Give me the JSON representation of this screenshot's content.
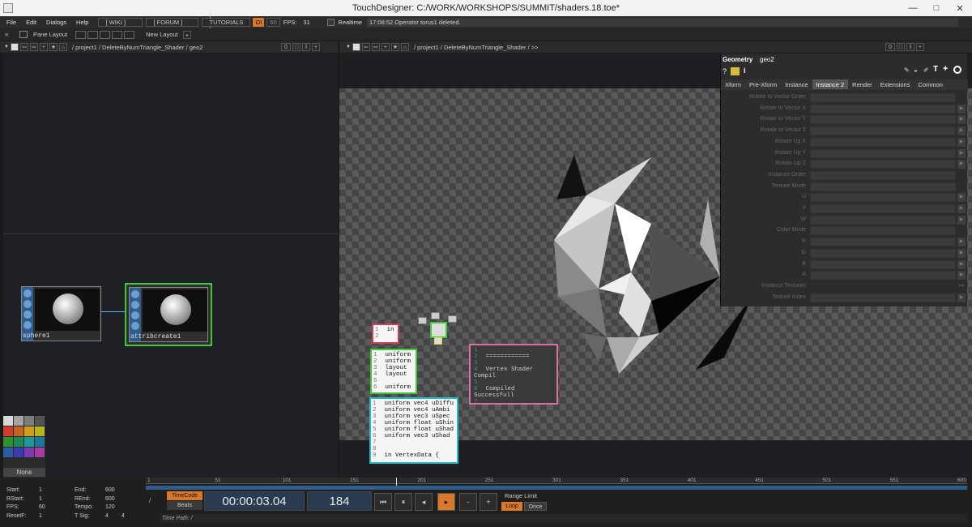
{
  "window": {
    "title": "TouchDesigner: C:/WORK/WORKSHOPS/SUMMIT/shaders.18.toe*"
  },
  "menu": {
    "items": [
      "File",
      "Edit",
      "Dialogs",
      "Help"
    ],
    "links": [
      "[ WIKI ]",
      "[ FORUM ]",
      "[ TUTORIALS ]"
    ],
    "oi": "OI",
    "fps_target": "60",
    "fps_label": "FPS:",
    "fps_value": "31",
    "realtime": "Realtime",
    "status": "17:08:52 Operator torus1 deleted."
  },
  "layoutbar": {
    "pane_layout": "Pane Layout",
    "new_layout": "New Layout",
    "plus": "+"
  },
  "leftpane": {
    "path": "/ project1 / DeleteByNumTriangle_Shader / geo2",
    "num": "0"
  },
  "rightpane": {
    "path": "/ project1 / DeleteByNumTriangle_Shader / >>",
    "num": "0"
  },
  "nodes": {
    "sphere": "sphere1",
    "attrib": "attribcreate1"
  },
  "code": {
    "red": [
      "1",
      "2"
    ],
    "red_text": "in",
    "green": [
      "uniform",
      "uniform",
      "layout",
      "layout",
      "",
      "uniform"
    ],
    "cyan": [
      "uniform vec4 uDiffu",
      "uniform vec4 uAmbi",
      "uniform vec3 uSpec",
      "uniform float uShin",
      "uniform float uShad",
      "uniform vec3 uShad",
      "",
      "",
      "in VertexData {"
    ],
    "pink": [
      "",
      "============",
      "",
      "Vertex Shader Compil",
      "",
      "Compiled Successfull",
      "",
      "============",
      ""
    ]
  },
  "params": {
    "type": "Geometry",
    "name": "geo2",
    "tabs": [
      "Xform",
      "Pre-Xform",
      "Instance",
      "Instance 2",
      "Render",
      "Extensions",
      "Common"
    ],
    "active_tab": "Instance 2",
    "rows": [
      {
        "label": "Rotate to Vector Order",
        "value": "",
        "kind": "menu"
      },
      {
        "label": "Rotate to Vector X",
        "value": "",
        "kind": "arrow"
      },
      {
        "label": "Rotate to Vector Y",
        "value": "",
        "kind": "arrow"
      },
      {
        "label": "Rotate to Vector Z",
        "value": "",
        "kind": "arrow"
      },
      {
        "label": "Rotate Up X",
        "value": "",
        "kind": "arrow"
      },
      {
        "label": "Rotate Up Y",
        "value": "",
        "kind": "arrow"
      },
      {
        "label": "Rotate Up Z",
        "value": "",
        "kind": "arrow"
      },
      {
        "label": "Instance Order",
        "value": "",
        "kind": "menu"
      },
      {
        "label": "Texture Mode",
        "value": "",
        "kind": "menu"
      },
      {
        "label": "U",
        "value": "",
        "kind": "arrow"
      },
      {
        "label": "V",
        "value": "",
        "kind": "arrow"
      },
      {
        "label": "W",
        "value": "",
        "kind": "arrow"
      },
      {
        "label": "Color Mode",
        "value": "",
        "kind": "menu"
      },
      {
        "label": "R",
        "value": "",
        "kind": "arrow"
      },
      {
        "label": "G",
        "value": "",
        "kind": "arrow"
      },
      {
        "label": "B",
        "value": "",
        "kind": "arrow"
      },
      {
        "label": "A",
        "value": "",
        "kind": "arrow"
      },
      {
        "label": "Instance Textures",
        "value": "",
        "kind": "more"
      },
      {
        "label": "Texture Index",
        "value": "",
        "kind": "arrow"
      }
    ],
    "more": ">>"
  },
  "palette": {
    "none": "None",
    "colors": [
      "#d8d8d8",
      "#a5a5a5",
      "#7d7d7d",
      "#545454",
      "#d23b2b",
      "#c4641f",
      "#cf9e1b",
      "#b8b41b",
      "#2e8f2d",
      "#1a8a55",
      "#1b9a98",
      "#197a9e",
      "#2c5ba8",
      "#3c3ab0",
      "#7b3cb0",
      "#a83aa0"
    ]
  },
  "timebar": {
    "ticks": [
      "1",
      "51",
      "101",
      "151",
      "201",
      "251",
      "301",
      "351",
      "401",
      "451",
      "501",
      "551",
      "600"
    ],
    "stats": [
      {
        "k": "Start:",
        "v": "1",
        "k2": "End:",
        "v2": "600"
      },
      {
        "k": "RStart:",
        "v": "1",
        "k2": "REnd:",
        "v2": "600"
      },
      {
        "k": "FPS:",
        "v": "60",
        "k2": "Tempo:",
        "v2": "120"
      },
      {
        "k": "ResetF:",
        "v": "1",
        "k2": "T Sig:",
        "v2": "4",
        "v3": "4"
      }
    ],
    "timecode": "TimeCode",
    "beats": "Beats",
    "time": "00:00:03.04",
    "frame": "184",
    "range_limit": "Range Limit",
    "loop": "Loop",
    "once": "Once",
    "timepath": "Time Path: /",
    "slash": "/"
  }
}
